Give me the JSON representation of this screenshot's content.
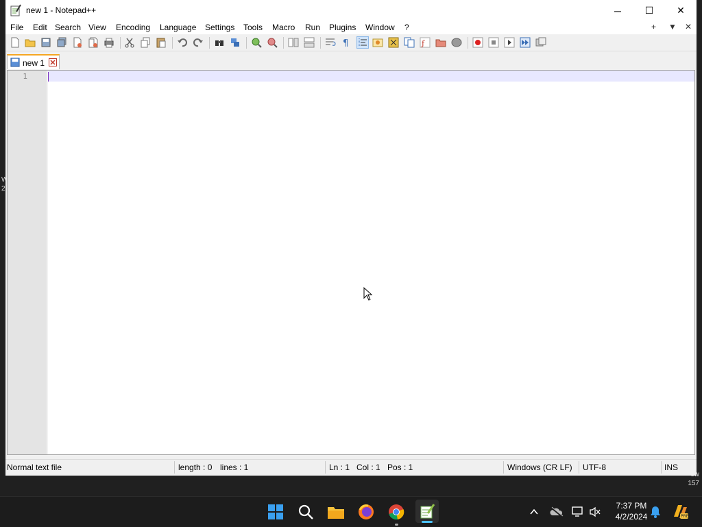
{
  "window": {
    "title": "new 1 - Notepad++",
    "controls": {
      "minimize": "─",
      "maximize": "☐",
      "close": "✕"
    }
  },
  "menubar": {
    "items": [
      "File",
      "Edit",
      "Search",
      "View",
      "Encoding",
      "Language",
      "Settings",
      "Tools",
      "Macro",
      "Run",
      "Plugins",
      "Window",
      "?"
    ],
    "right": {
      "add": "+",
      "list": "▼",
      "close": "✕"
    }
  },
  "tabs": [
    {
      "label": "new 1",
      "close_icon": "close-tab-icon"
    }
  ],
  "editor": {
    "line_numbers": [
      "1"
    ],
    "content": ""
  },
  "statusbar": {
    "file_type": "Normal text file",
    "length": "length : 0",
    "lines": "lines : 1",
    "ln": "Ln : 1",
    "col": "Col : 1",
    "pos": "Pos : 1",
    "eol": "Windows (CR LF)",
    "encoding": "UTF-8",
    "mode": "INS"
  },
  "taskbar": {
    "time": "7:37 PM",
    "date": "4/2/2024",
    "apps": [
      "windows-start-icon",
      "search-icon",
      "file-explorer-icon",
      "firefox-icon",
      "chrome-icon",
      "notepadpp-icon"
    ],
    "tray": [
      "chevron-up-icon",
      "onedrive-icon",
      "network-icon",
      "volume-muted-icon",
      "notification-bell-icon",
      "copilot-icon"
    ]
  },
  "desktop": {
    "left_text": [
      "W",
      "2"
    ],
    "right_text": [
      "ew",
      "157"
    ]
  },
  "colors": {
    "tab_accent": "#f5a623",
    "current_line": "#e8e8ff",
    "caret": "#7b2fbf"
  }
}
